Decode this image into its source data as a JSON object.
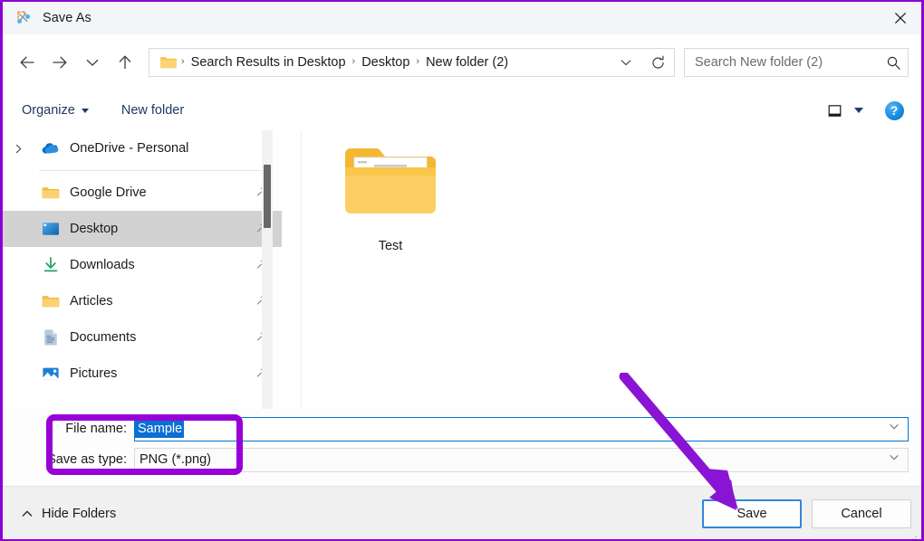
{
  "window": {
    "title": "Save As",
    "title_icon": "snip-tool-icon",
    "close_label": "✕"
  },
  "nav": {
    "back_icon": "arrow-left-icon",
    "forward_icon": "arrow-right-icon",
    "recent_icon": "chevron-down-icon",
    "up_icon": "arrow-up-icon",
    "breadcrumb_folder_icon": "folder-icon",
    "breadcrumb": [
      "Search Results in Desktop",
      "Desktop",
      "New folder (2)"
    ],
    "separator": "›",
    "breadcrumb_dropdown_icon": "chevron-down-icon",
    "refresh_icon": "refresh-icon"
  },
  "search": {
    "placeholder": "Search New folder (2)",
    "value": "",
    "icon": "search-icon"
  },
  "toolbar": {
    "organize_label": "Organize",
    "new_folder_label": "New folder",
    "view_icon": "view-pane-icon",
    "view_caret_icon": "caret-down-icon",
    "help_label": "?",
    "help_icon": "help-circle-icon"
  },
  "sidebar": {
    "items": [
      {
        "label": "OneDrive - Personal",
        "icon": "onedrive-cloud-icon",
        "expandable": true,
        "pinned": false,
        "selected": false
      },
      {
        "label": "Google Drive",
        "icon": "folder-icon",
        "expandable": false,
        "pinned": true,
        "selected": false
      },
      {
        "label": "Desktop",
        "icon": "desktop-monitor-icon",
        "expandable": false,
        "pinned": true,
        "selected": true
      },
      {
        "label": "Downloads",
        "icon": "download-arrow-icon",
        "expandable": false,
        "pinned": true,
        "selected": false
      },
      {
        "label": "Articles",
        "icon": "folder-icon",
        "expandable": false,
        "pinned": true,
        "selected": false
      },
      {
        "label": "Documents",
        "icon": "document-icon",
        "expandable": false,
        "pinned": true,
        "selected": false
      },
      {
        "label": "Pictures",
        "icon": "pictures-icon",
        "expandable": false,
        "pinned": true,
        "selected": false
      }
    ],
    "pin_icon": "pin-icon",
    "expand_icon": "chevron-right-icon"
  },
  "files": [
    {
      "name": "Test",
      "icon": "folder-with-document-icon"
    }
  ],
  "form": {
    "file_name_label": "File name:",
    "file_name_value": "Sample",
    "file_name_selected": true,
    "save_as_type_label": "Save as type:",
    "save_as_type_value": "PNG (*.png)",
    "dropdown_icon": "chevron-down-icon"
  },
  "footer": {
    "hide_folders_label": "Hide Folders",
    "hide_folders_icon": "chevron-up-icon",
    "save_label": "Save",
    "cancel_label": "Cancel"
  },
  "annotations": {
    "highlight_color": "#9800d8",
    "arrow_color": "#8a14d4",
    "arrow_target": "Save",
    "rect_target": "file name and save as type fields"
  },
  "colors": {
    "accent_blue": "#0078d4",
    "selection_blue": "#0b6fd3",
    "titlebar_bg": "#f3f5f9",
    "footer_bg": "#f0f0f0",
    "sidebar_selected": "#d2d2d2",
    "command_text": "#1f3864"
  }
}
